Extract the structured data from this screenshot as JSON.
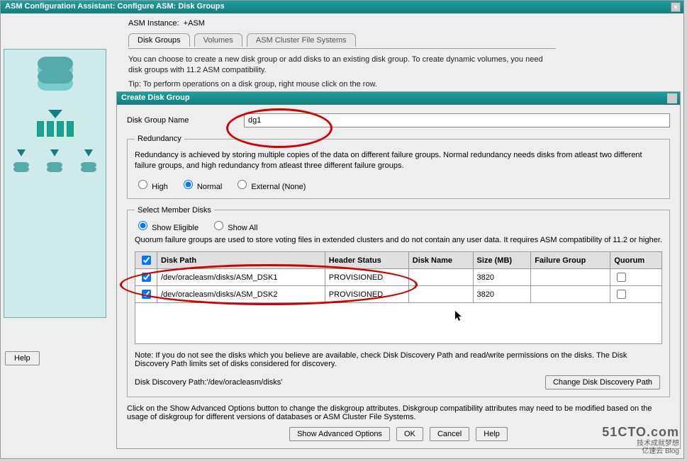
{
  "window": {
    "title": "ASM Configuration Assistant: Configure ASM: Disk Groups",
    "instance_label": "ASM Instance:",
    "instance_value": "+ASM"
  },
  "tabs": [
    {
      "label": "Disk Groups",
      "active": true
    },
    {
      "label": "Volumes",
      "active": false
    },
    {
      "label": "ASM Cluster File Systems",
      "active": false
    }
  ],
  "intro_line1": "You can choose to create a new disk group or add disks to an existing disk group. To create dynamic volumes, you need disk groups with 11.2 ASM compatibility.",
  "intro_line2": "Tip: To perform operations on a disk group, right mouse click on the row.",
  "dialog": {
    "title": "Create Disk Group",
    "disk_group_name_label": "Disk Group Name",
    "disk_group_name_value": "dg1",
    "redundancy": {
      "legend": "Redundancy",
      "desc": "Redundancy is achieved by storing multiple copies of the data on different failure groups. Normal redundancy needs disks from atleast two different failure groups, and high redundancy from atleast three different failure groups.",
      "options": [
        "High",
        "Normal",
        "External (None)"
      ],
      "selected": "Normal"
    },
    "member_disks": {
      "legend": "Select Member Disks",
      "view_options": [
        "Show Eligible",
        "Show All"
      ],
      "view_selected": "Show Eligible",
      "quorum_desc": "Quorum failure groups are used to store voting files in extended clusters and do not contain any user data. It requires ASM compatibility of 11.2 or higher.",
      "columns": [
        "",
        "Disk Path",
        "Header Status",
        "Disk Name",
        "Size (MB)",
        "Failure Group",
        "Quorum"
      ],
      "rows": [
        {
          "checked": true,
          "path": "/dev/oracleasm/disks/ASM_DSK1",
          "status": "PROVISIONED",
          "name": "",
          "size": "3820",
          "failure_group": "",
          "quorum": false
        },
        {
          "checked": true,
          "path": "/dev/oracleasm/disks/ASM_DSK2",
          "status": "PROVISIONED",
          "name": "",
          "size": "3820",
          "failure_group": "",
          "quorum": false
        }
      ],
      "note": "Note: If you do not see the disks which you believe are available, check Disk Discovery Path and read/write permissions on the disks. The Disk Discovery Path limits set of disks considered for discovery.",
      "discovery_path_label": "Disk Discovery Path:'/dev/oracleasm/disks'",
      "change_path_btn": "Change Disk Discovery Path"
    },
    "footer_note": "Click on the Show Advanced Options button to change the diskgroup attributes. Diskgroup compatibility attributes may need to be modified based on the usage of diskgroup for different versions of databases or ASM Cluster File Systems.",
    "buttons": {
      "advanced": "Show Advanced Options",
      "ok": "OK",
      "cancel": "Cancel",
      "help": "Help"
    }
  },
  "help_button": "Help",
  "watermark": {
    "big": "51CTO.com",
    "line2": "技术成就梦想",
    "line3": "亿速云 Blog"
  }
}
